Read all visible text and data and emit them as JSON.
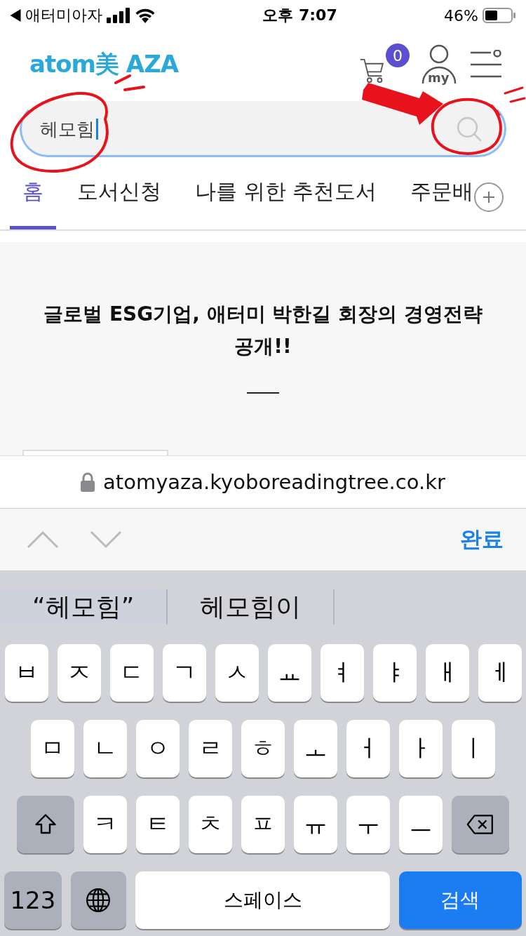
{
  "status_bar": {
    "carrier": "애터미아자",
    "time": "오후 7:07",
    "battery": "46%"
  },
  "header": {
    "logo": "atom美 AZA",
    "cart_count": "0",
    "account_label": "my"
  },
  "search": {
    "value": "헤모힘"
  },
  "tabs": [
    {
      "label": "홈",
      "selected": true
    },
    {
      "label": "도서신청",
      "selected": false
    },
    {
      "label": "나를 위한 추천도서",
      "selected": false
    },
    {
      "label": "주문배",
      "selected": false
    }
  ],
  "article": {
    "heading": "글로벌 ESG기업, 애터미 박한길 회장의 경영전략 공개!!"
  },
  "browser": {
    "url": "atomyaza.kyoboreadingtree.co.kr",
    "done": "완료"
  },
  "suggestions": [
    "“헤모힘”",
    "헤모힘이"
  ],
  "keyboard": [
    [
      {
        "kind": "letter",
        "label": "ㅂ"
      },
      {
        "kind": "letter",
        "label": "ㅈ"
      },
      {
        "kind": "letter",
        "label": "ㄷ"
      },
      {
        "kind": "letter",
        "label": "ㄱ"
      },
      {
        "kind": "letter",
        "label": "ㅅ"
      },
      {
        "kind": "letter",
        "label": "ㅛ"
      },
      {
        "kind": "letter",
        "label": "ㅕ"
      },
      {
        "kind": "letter",
        "label": "ㅑ"
      },
      {
        "kind": "letter",
        "label": "ㅐ"
      },
      {
        "kind": "letter",
        "label": "ㅔ"
      }
    ],
    [
      {
        "kind": "letter",
        "label": "ㅁ"
      },
      {
        "kind": "letter",
        "label": "ㄴ"
      },
      {
        "kind": "letter",
        "label": "ㅇ"
      },
      {
        "kind": "letter",
        "label": "ㄹ"
      },
      {
        "kind": "letter",
        "label": "ㅎ"
      },
      {
        "kind": "letter",
        "label": "ㅗ"
      },
      {
        "kind": "letter",
        "label": "ㅓ"
      },
      {
        "kind": "letter",
        "label": "ㅏ"
      },
      {
        "kind": "letter",
        "label": "ㅣ"
      }
    ],
    [
      {
        "kind": "shift"
      },
      {
        "kind": "letter",
        "label": "ㅋ"
      },
      {
        "kind": "letter",
        "label": "ㅌ"
      },
      {
        "kind": "letter",
        "label": "ㅊ"
      },
      {
        "kind": "letter",
        "label": "ㅍ"
      },
      {
        "kind": "letter",
        "label": "ㅠ"
      },
      {
        "kind": "letter",
        "label": "ㅜ"
      },
      {
        "kind": "letter",
        "label": "ㅡ"
      },
      {
        "kind": "backspace"
      }
    ],
    [
      {
        "kind": "numbers",
        "label": "123"
      },
      {
        "kind": "globe"
      },
      {
        "kind": "space",
        "label": "스페이스"
      },
      {
        "kind": "search",
        "label": "검색"
      }
    ]
  ]
}
